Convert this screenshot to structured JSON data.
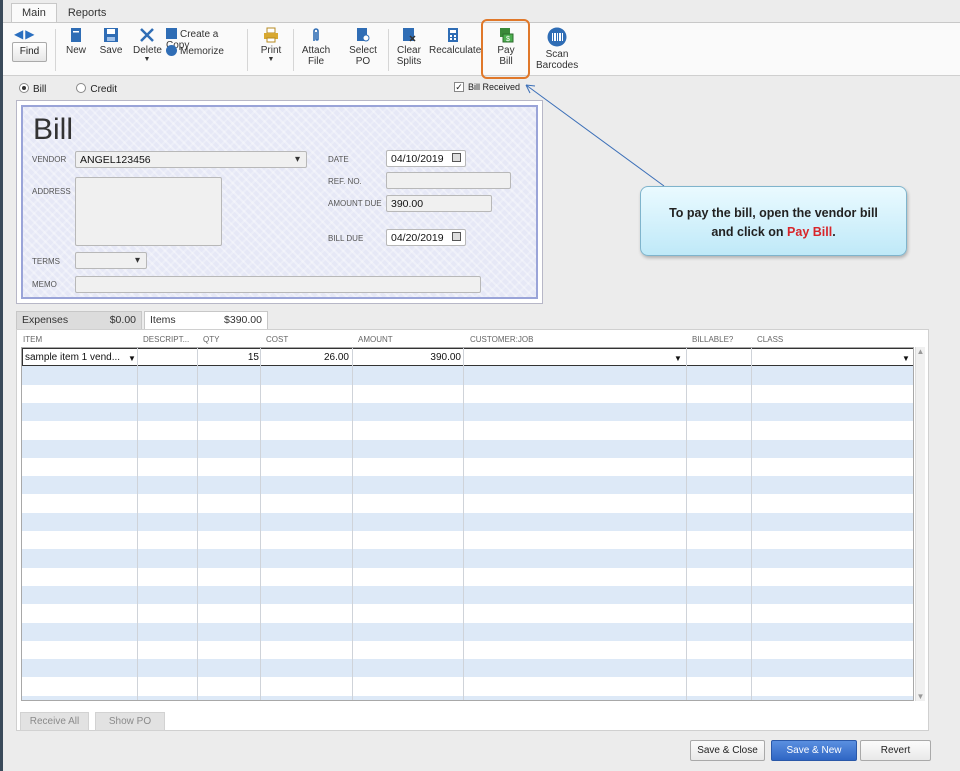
{
  "ribbon": {
    "tabs": [
      "Main",
      "Reports"
    ],
    "find_label": "Find",
    "buttons": {
      "new": "New",
      "save": "Save",
      "delete": "Delete",
      "create_copy": "Create a Copy",
      "memorize": "Memorize",
      "print": "Print",
      "attach_file_1": "Attach",
      "attach_file_2": "File",
      "select_po_1": "Select",
      "select_po_2": "PO",
      "clear_splits_1": "Clear",
      "clear_splits_2": "Splits",
      "recalculate": "Recalculate",
      "pay_bill_1": "Pay",
      "pay_bill_2": "Bill",
      "scan_barcodes_1": "Scan",
      "scan_barcodes_2": "Barcodes"
    }
  },
  "form": {
    "type_bill": "Bill",
    "type_credit": "Credit",
    "bill_received": "Bill Received",
    "title": "Bill",
    "vendor_label": "VENDOR",
    "vendor": "ANGEL123456",
    "address_label": "ADDRESS",
    "terms_label": "TERMS",
    "memo_label": "MEMO",
    "date_label": "DATE",
    "date": "04/10/2019",
    "ref_label": "REF. NO.",
    "amount_due_label": "AMOUNT DUE",
    "amount_due": "390.00",
    "bill_due_label": "BILL DUE",
    "bill_due": "04/20/2019"
  },
  "subtabs": {
    "expenses_label": "Expenses",
    "expenses_total": "$0.00",
    "items_label": "Items",
    "items_total": "$390.00"
  },
  "grid": {
    "columns": [
      "ITEM",
      "DESCRIPT...",
      "QTY",
      "COST",
      "AMOUNT",
      "CUSTOMER:JOB",
      "BILLABLE?",
      "CLASS"
    ],
    "rows": [
      {
        "item": "sample item 1 vend...",
        "description": "",
        "qty": "15",
        "cost": "26.00",
        "amount": "390.00",
        "customer_job": "",
        "billable": "",
        "class": ""
      }
    ]
  },
  "footer": {
    "receive_all": "Receive All",
    "show_po": "Show PO",
    "save_close": "Save & Close",
    "save_new": "Save & New",
    "revert": "Revert"
  },
  "callout": {
    "line1": "To pay the bill,  open the vendor bill",
    "line2_a": "and click on ",
    "line2_b": "Pay Bill",
    "line2_c": "."
  },
  "colors": {
    "highlight_border": "#e0782a",
    "callout_red": "#d8252a",
    "primary_button": "#2f66c4"
  }
}
